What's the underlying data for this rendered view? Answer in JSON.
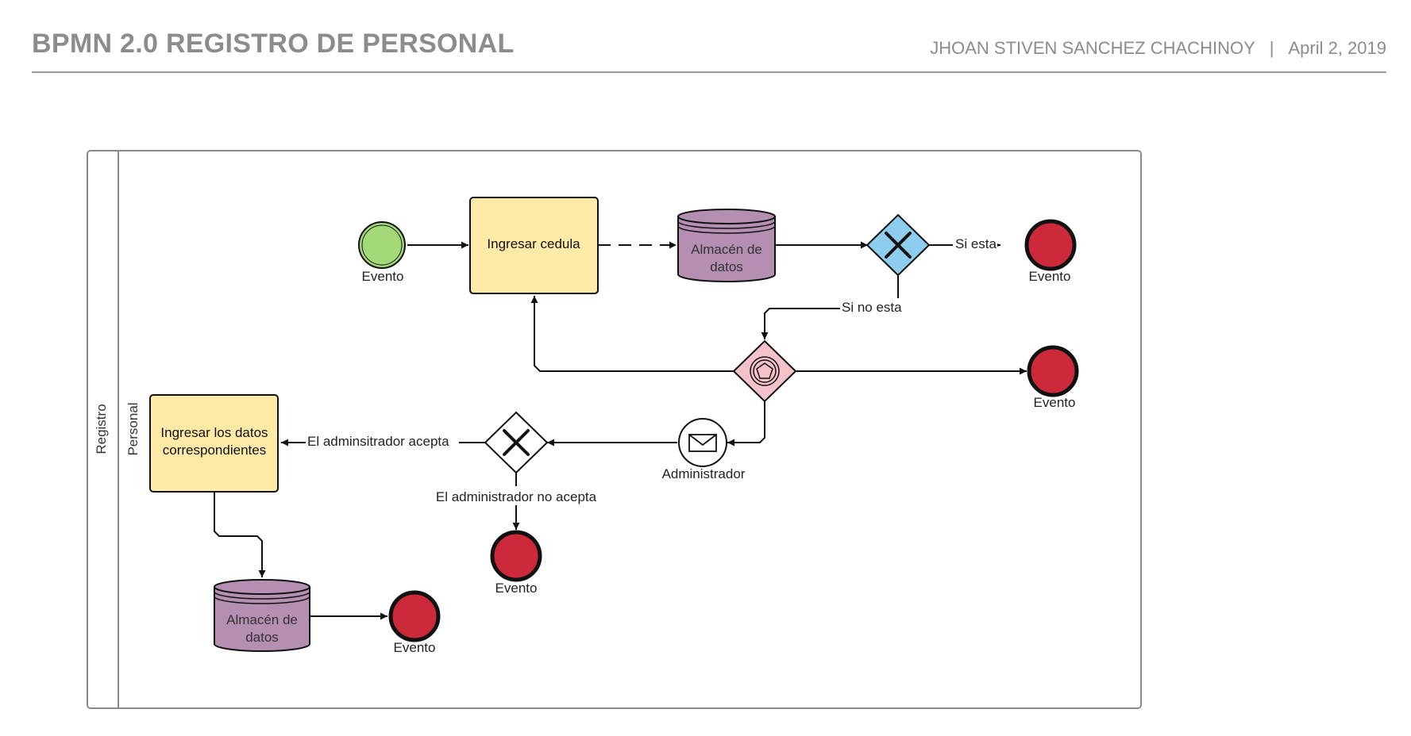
{
  "header": {
    "title": "BPMN 2.0 REGISTRO DE PERSONAL",
    "author": "JHOAN STIVEN SANCHEZ CHACHINOY",
    "separator": "|",
    "date": "April 2, 2019"
  },
  "pool": {
    "label": "Registro"
  },
  "lane": {
    "label": "Personal"
  },
  "tasks": {
    "ingresar_cedula": "Ingresar cedula",
    "ingresar_datos_line1": "Ingresar los datos",
    "ingresar_datos_line2": "correspondientes"
  },
  "stores": {
    "top_line1": "Almacén de",
    "top_line2": "datos",
    "bottom_line1": "Almacén de",
    "bottom_line2": "datos"
  },
  "events": {
    "start": "Evento",
    "end_si_esta": "Evento",
    "end_event_gateway": "Evento",
    "end_no_acepta": "Evento",
    "end_final": "Evento",
    "message": "Administrador"
  },
  "flows": {
    "si_esta": "Si esta",
    "si_no_esta": "Si no esta",
    "acepta": "El adminsitrador acepta",
    "no_acepta": "El administrador no acepta"
  },
  "colors": {
    "start_event": "#a3d977",
    "end_event": "#cc2a3a",
    "task": "#ffeaa7",
    "data_store": "#b48fb2",
    "gateway_blue": "#8fcdee",
    "gateway_pink": "#f4c2c8",
    "line": "#111111",
    "header_text": "#8c8c8c"
  }
}
